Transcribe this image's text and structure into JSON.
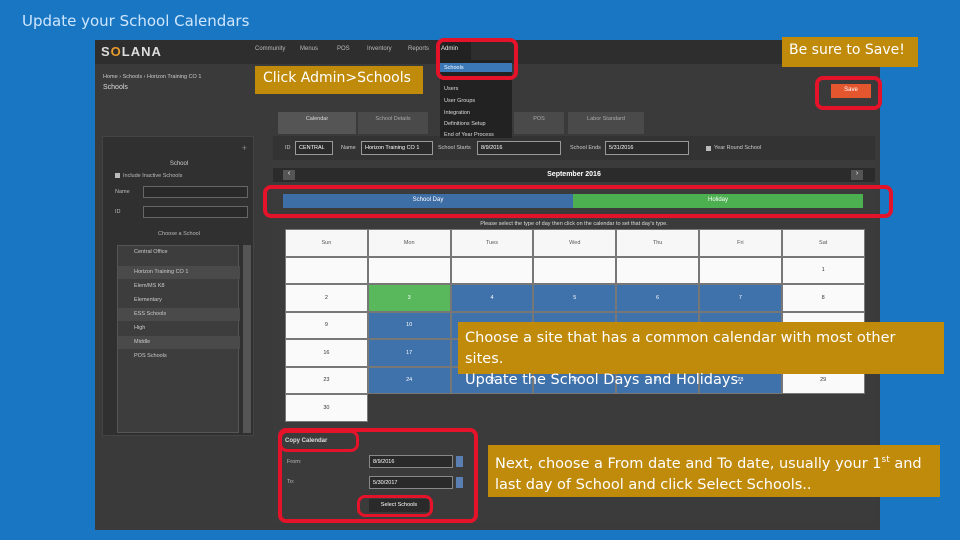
{
  "slide": {
    "title": "Update your School Calendars"
  },
  "app": {
    "logo": {
      "pre": "S",
      "accent": "O",
      "post": "LANA"
    },
    "nav": [
      "Community",
      "Menus",
      "POS",
      "Inventory",
      "Reports"
    ],
    "admin_tab": "Admin",
    "admin_menu": [
      "Schools",
      "Users",
      "User Groups",
      "Integration",
      "Definitions Setup",
      "End of Year Process"
    ],
    "breadcrumb": "Home › Schools › Horizon Training CO 1",
    "page_title": "Schools",
    "save_label": "Save",
    "tabs": [
      "Calendar",
      "School Details",
      "POS",
      "Labor Standard"
    ],
    "left_panel": {
      "title": "School",
      "include_inactive": "Include Inactive Schools",
      "name_label": "Name",
      "id_label": "ID",
      "choose_label": "Choose a School",
      "schools": [
        "Central Office",
        "Horizon Training CO 1",
        "Elem/MS K8",
        "Elementary",
        "ESS Schools",
        "High",
        "Middle",
        "POS Schools"
      ]
    },
    "fields": {
      "id_label": "ID",
      "id_value": "CENTRAL",
      "name_label": "Name",
      "name_value": "Horizon Training CO 1",
      "start_label": "School Starts",
      "start_value": "8/9/2016",
      "end_label": "School Ends",
      "end_value": "5/31/2016",
      "year_round": "Year Round School"
    },
    "calendar": {
      "prev": "‹",
      "next": "›",
      "month": "September 2016",
      "school_day": "School Day",
      "holiday": "Holiday",
      "instruction": "Please select the type of day then click on the calendar to set that day's type.",
      "days": [
        "Sun",
        "Mon",
        "Tues",
        "Wed",
        "Thu",
        "Fri",
        "Sat"
      ],
      "weeks": [
        [
          {
            "d": "",
            "t": "blank"
          },
          {
            "d": "",
            "t": "blank"
          },
          {
            "d": "",
            "t": "blank"
          },
          {
            "d": "",
            "t": "blank"
          },
          {
            "d": "",
            "t": "blank"
          },
          {
            "d": "",
            "t": "blank"
          },
          {
            "d": "1",
            "t": "blank"
          }
        ],
        [
          {
            "d": "2",
            "t": "blank"
          },
          {
            "d": "3",
            "t": "hol"
          },
          {
            "d": "4",
            "t": "sd"
          },
          {
            "d": "5",
            "t": "sd"
          },
          {
            "d": "6",
            "t": "sd"
          },
          {
            "d": "7",
            "t": "sd"
          },
          {
            "d": "8",
            "t": "blank"
          }
        ],
        [
          {
            "d": "9",
            "t": "blank"
          },
          {
            "d": "10",
            "t": "sd"
          },
          {
            "d": "",
            "t": "sd"
          },
          {
            "d": "",
            "t": "sd"
          },
          {
            "d": "",
            "t": "sd"
          },
          {
            "d": "",
            "t": "sd"
          },
          {
            "d": "",
            "t": "blank"
          }
        ],
        [
          {
            "d": "16",
            "t": "blank"
          },
          {
            "d": "17",
            "t": "sd"
          },
          {
            "d": "",
            "t": "sd"
          },
          {
            "d": "",
            "t": "sd"
          },
          {
            "d": "",
            "t": "sd"
          },
          {
            "d": "",
            "t": "sd"
          },
          {
            "d": "",
            "t": "blank"
          }
        ],
        [
          {
            "d": "23",
            "t": "blank"
          },
          {
            "d": "24",
            "t": "sd"
          },
          {
            "d": "25",
            "t": "sd"
          },
          {
            "d": "26",
            "t": "sd"
          },
          {
            "d": "27",
            "t": "sd"
          },
          {
            "d": "28",
            "t": "sd"
          },
          {
            "d": "29",
            "t": "blank"
          }
        ],
        [
          {
            "d": "30",
            "t": "blank"
          },
          {
            "d": "",
            "t": "dark"
          },
          {
            "d": "",
            "t": "dark"
          },
          {
            "d": "",
            "t": "dark"
          },
          {
            "d": "",
            "t": "dark"
          },
          {
            "d": "",
            "t": "dark"
          },
          {
            "d": "",
            "t": "dark"
          }
        ]
      ]
    },
    "copy": {
      "title": "Copy Calendar",
      "from_label": "From:",
      "from_value": "8/9/2016",
      "to_label": "To:",
      "to_value": "5/30/2017",
      "select_label": "Select Schools"
    }
  },
  "callouts": {
    "admin": "Click Admin>Schools",
    "save": "Be sure to Save!",
    "site_line1": "Choose a site that has a common calendar with most other sites.",
    "site_line2": "Update the School Days and Holidays.",
    "copy_pre": "Next, choose a From date and To date, usually your 1",
    "copy_sup": "st",
    "copy_post": " and last day of School and click Select Schools.."
  },
  "colors": {
    "background": "#1976c2",
    "callout": "#c08a0b",
    "highlight": "#e5132a",
    "school_day": "#3d6ea6",
    "holiday": "#4caf50"
  }
}
